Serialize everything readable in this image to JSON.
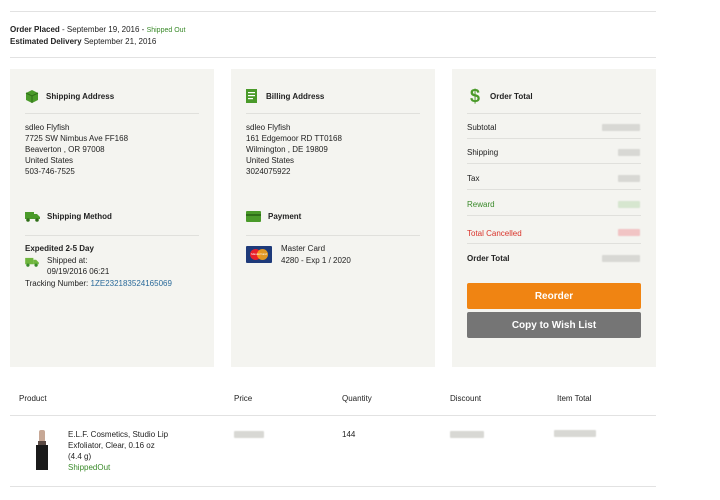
{
  "order": {
    "placed_label": "Order Placed",
    "placed_date": "- September 19, 2016 -",
    "status": "Shipped Out",
    "delivery_label": "Estimated Delivery",
    "delivery_date": "September 21, 2016"
  },
  "shipping_address": {
    "title": "Shipping Address",
    "lines": [
      "sdleo Flyfish",
      "7725 SW Nimbus Ave FF168",
      "Beaverton , OR 97008",
      "United States",
      "503-746-7525"
    ]
  },
  "shipping_method": {
    "title": "Shipping Method",
    "method": "Expedited 2-5 Day",
    "shipped_at_label": "Shipped at:",
    "shipped_at": "09/19/2016 06:21",
    "tracking_label": "Tracking Number:",
    "tracking_number": "1ZE232183524165069"
  },
  "billing_address": {
    "title": "Billing Address",
    "lines": [
      "sdleo Flyfish",
      "161 Edgemoor RD TT0168",
      "Wilmington , DE 19809",
      "United States",
      "3024075922"
    ]
  },
  "payment": {
    "title": "Payment",
    "card_type": "Master Card",
    "card_detail": "4280 - Exp 1 / 2020",
    "card_logo_text": "MasterCard"
  },
  "order_total": {
    "title": "Order Total",
    "rows": [
      {
        "label": "Subtotal"
      },
      {
        "label": "Shipping"
      },
      {
        "label": "Tax"
      },
      {
        "label": "Reward"
      },
      {
        "label": "Total Cancelled"
      },
      {
        "label": "Order Total"
      }
    ],
    "reorder_label": "Reorder",
    "wishlist_label": "Copy to Wish List"
  },
  "products": {
    "headers": [
      "Product",
      "Price",
      "Quantity",
      "Discount",
      "Item Total"
    ],
    "items": [
      {
        "name_line1": "E.L.F. Cosmetics, Studio Lip",
        "name_line2": "Exfoliator, Clear, 0.16 oz",
        "name_line3": "(4.4 g)",
        "status": "ShippedOut",
        "quantity": "144"
      }
    ]
  },
  "colors": {
    "accent_green": "#3a8a2a",
    "reorder_orange": "#f08412",
    "wishlist_gray": "#757575",
    "panel_bg": "#f4f4f0",
    "cancelled_red": "#d9342b",
    "link_blue": "#2a6a9a"
  },
  "icons": {
    "shipping_address": "box-icon",
    "shipping_method": "truck-icon",
    "billing_address": "document-icon",
    "payment": "credit-card-icon",
    "order_total": "dollar-icon",
    "shipped": "truck-icon"
  }
}
